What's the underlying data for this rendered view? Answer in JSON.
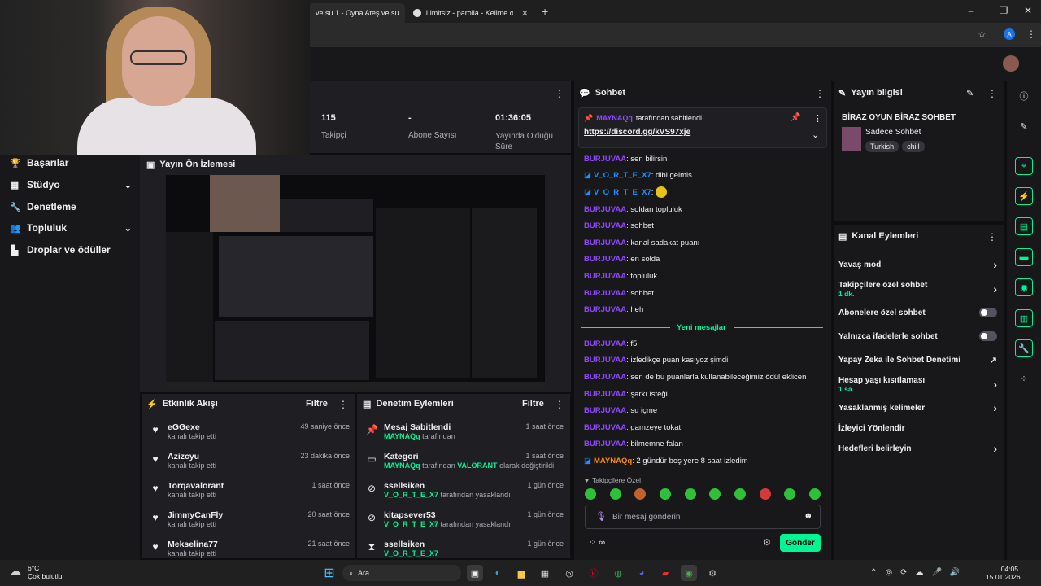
{
  "browser": {
    "tabs": [
      {
        "label": "ve su 1 - Oyna Ateş ve su"
      },
      {
        "label": "Limitsiz - parolla - Kelime oyunu"
      }
    ],
    "new_tab": "+",
    "profile_letter": "A"
  },
  "nav": {
    "items": [
      {
        "label": "Başarılar",
        "icon": "trophy-icon"
      },
      {
        "label": "Stüdyo",
        "icon": "studio-icon"
      },
      {
        "label": "Denetleme",
        "icon": "wrench-icon"
      },
      {
        "label": "Topluluk",
        "icon": "community-icon"
      },
      {
        "label": "Droplar ve ödüller",
        "icon": "drops-icon"
      }
    ]
  },
  "stats": [
    {
      "value": "115",
      "label": "Takipçi"
    },
    {
      "value": "-",
      "label": "Abone Sayısı"
    },
    {
      "value": "01:36:05",
      "label": "Yayında Olduğu Süre"
    }
  ],
  "preview": {
    "title": "Yayın Ön İzlemesi"
  },
  "activity": {
    "title": "Etkinlik Akışı",
    "filter": "Filtre",
    "items": [
      {
        "name": "eGGexe",
        "sub": "kanalı takip etti",
        "time": "49 saniye önce"
      },
      {
        "name": "Azizcyu",
        "sub": "kanalı takip etti",
        "time": "23 dakika önce"
      },
      {
        "name": "Torqavalorant",
        "sub": "kanalı takip etti",
        "time": "1 saat önce"
      },
      {
        "name": "JimmyCanFly",
        "sub": "kanalı takip etti",
        "time": "20 saat önce"
      },
      {
        "name": "Mekselina77",
        "sub": "kanalı takip etti",
        "time": "21 saat önce"
      }
    ]
  },
  "modlog": {
    "title": "Denetim Eylemleri",
    "filter": "Filtre",
    "items": [
      {
        "icon": "pin-icon",
        "name": "Mesaj Sabitlendi",
        "actor": "MAYNAQq",
        "sub": " tarafından",
        "extra": "",
        "extra_tail": "",
        "time": "1 saat önce"
      },
      {
        "icon": "category-icon",
        "name": "Kategori",
        "actor": "MAYNAQq",
        "sub": " tarafından ",
        "extra": "VALORANT",
        "extra_tail": " olarak değiştirildi",
        "time": "1 saat önce"
      },
      {
        "icon": "ban-icon",
        "name": "ssellsiken",
        "actor": "V_O_R_T_E_X7",
        "sub": " tarafından yasaklandı",
        "extra": "",
        "extra_tail": "",
        "time": "1 gün önce"
      },
      {
        "icon": "ban-icon",
        "name": "kitapsever53",
        "actor": "V_O_R_T_E_X7",
        "sub": " tarafından yasaklandı",
        "extra": "",
        "extra_tail": "",
        "time": "1 gün önce"
      },
      {
        "icon": "timeout-icon",
        "name": "ssellsiken",
        "actor": "V_O_R_T_E_X7",
        "sub": "",
        "extra": "",
        "extra_tail": "",
        "time": "1 gün önce"
      }
    ]
  },
  "chat": {
    "title": "Sohbet",
    "pinned_by": "MAYNAQq",
    "pinned_by_suffix": "tarafından sabitlendi",
    "pinned_link": "https://discord.gg/kVS97xje",
    "messages_before": [
      {
        "user": "BURJUVAA",
        "text": "sen bilirsin",
        "cls": "user"
      },
      {
        "user": "V_O_R_T_E_X7",
        "text": "dibi gelmis",
        "cls": "user2"
      },
      {
        "user": "V_O_R_T_E_X7",
        "text": "",
        "cls": "user2"
      },
      {
        "user": "BURJUVAA",
        "text": "soldan topluluk",
        "cls": "user"
      },
      {
        "user": "BURJUVAA",
        "text": "sohbet",
        "cls": "user"
      },
      {
        "user": "BURJUVAA",
        "text": "kanal sadakat puanı",
        "cls": "user"
      },
      {
        "user": "BURJUVAA",
        "text": "en solda",
        "cls": "user"
      },
      {
        "user": "BURJUVAA",
        "text": "topluluk",
        "cls": "user"
      },
      {
        "user": "BURJUVAA",
        "text": "sohbet",
        "cls": "user"
      },
      {
        "user": "BURJUVAA",
        "text": "heh",
        "cls": "user"
      }
    ],
    "new_messages": "Yeni mesajlar",
    "messages_after": [
      {
        "user": "BURJUVAA",
        "text": "f5",
        "cls": "user"
      },
      {
        "user": "BURJUVAA",
        "text": "izledikçe puan kasıyoz şimdi",
        "cls": "user"
      },
      {
        "user": "BURJUVAA",
        "text": "sen de bu puanlarla kullanabileceğimiz ödül eklicen",
        "cls": "user"
      },
      {
        "user": "BURJUVAA",
        "text": "şarkı isteği",
        "cls": "user"
      },
      {
        "user": "BURJUVAA",
        "text": "su içme",
        "cls": "user"
      },
      {
        "user": "BURJUVAA",
        "text": "gamzeye tokat",
        "cls": "user"
      },
      {
        "user": "BURJUVAA",
        "text": "bilmemne falan",
        "cls": "user"
      },
      {
        "user": "MAYNAQq",
        "text": "2 gündür boş yere 8 saat izledim",
        "cls": "user3"
      }
    ],
    "followers_only": "Takipçilere Özel",
    "input_placeholder": "Bir mesaj gönderin",
    "send": "Gönder"
  },
  "stream_info": {
    "title": "Yayın bilgisi",
    "stream_title": "BİRAZ OYUN BİRAZ SOHBET",
    "category": "Sadece Sohbet",
    "tags": [
      "Turkish",
      "chill"
    ]
  },
  "channel_actions": {
    "title": "Kanal Eylemleri",
    "items": [
      {
        "label": "Yavaş mod",
        "sub": "",
        "control": "arrow"
      },
      {
        "label": "Takipçilere özel sohbet",
        "sub": "1 dk.",
        "control": "arrow"
      },
      {
        "label": "Abonelere özel sohbet",
        "sub": "",
        "control": "toggle"
      },
      {
        "label": "Yalnızca ifadelerle sohbet",
        "sub": "",
        "control": "toggle"
      },
      {
        "label": "Yapay Zeka ile Sohbet Denetimi",
        "sub": "",
        "control": "external"
      },
      {
        "label": "Hesap yaşı kısıtlaması",
        "sub": "1 sa.",
        "control": "arrow"
      },
      {
        "label": "Yasaklanmış kelimeler",
        "sub": "",
        "control": "arrow"
      },
      {
        "label": "İzleyici Yönlendir",
        "sub": "",
        "control": "none"
      },
      {
        "label": "Hedefleri belirleyin",
        "sub": "",
        "control": "arrow"
      }
    ]
  },
  "taskbar": {
    "weather_temp": "6°C",
    "weather_desc": "Çok bulutlu",
    "search": "Ara",
    "time": "04:05",
    "date": "15.01.2026"
  },
  "colors": {
    "accent": "#9147ff",
    "green": "#00f593"
  }
}
